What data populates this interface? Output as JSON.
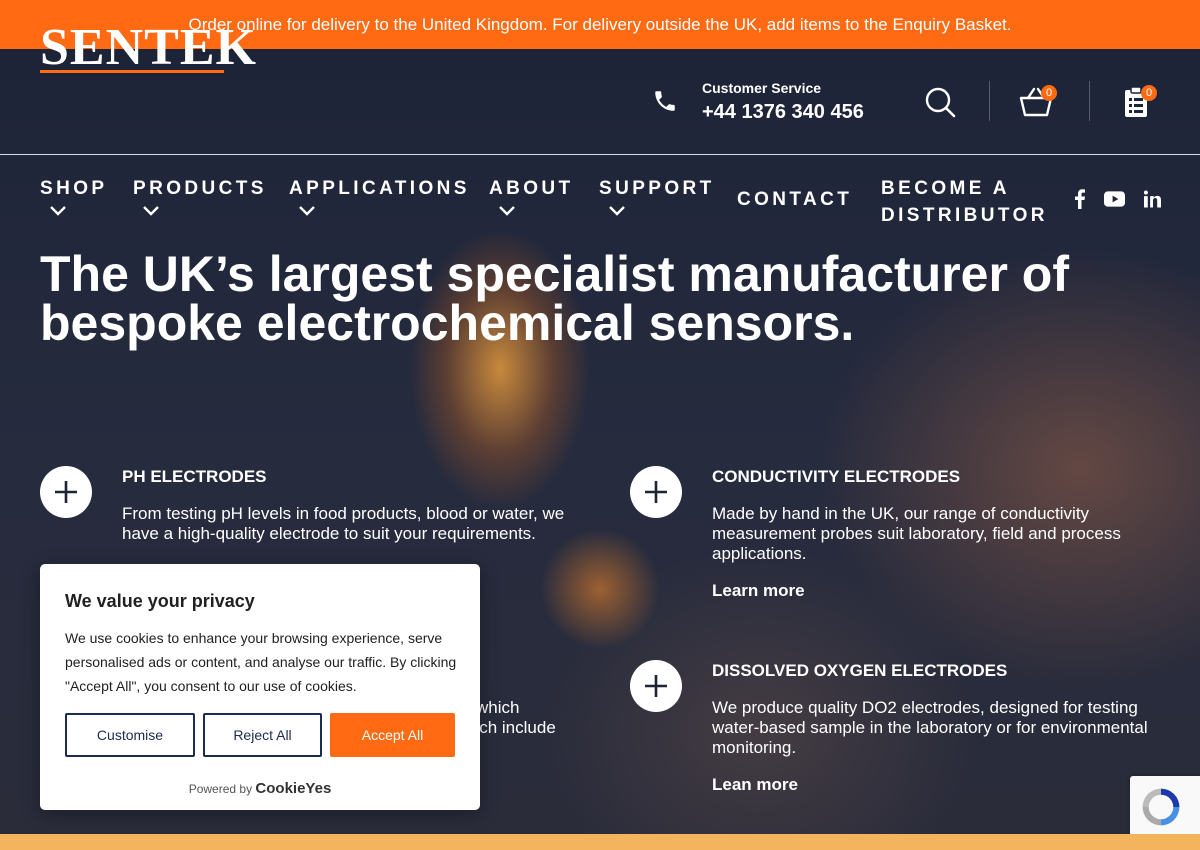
{
  "topbar": {
    "message": "Order online for delivery to the United Kingdom. For delivery outside the UK, add items to the Enquiry Basket."
  },
  "header": {
    "logo": "SENTEK",
    "customer_service_label": "Customer Service",
    "phone": "+44 1376 340 456",
    "cart_count": "0",
    "enquiry_count": "0"
  },
  "nav": {
    "items": [
      {
        "label": "SHOP",
        "dropdown": true
      },
      {
        "label": "PRODUCTS",
        "dropdown": true
      },
      {
        "label": "APPLICATIONS",
        "dropdown": true
      },
      {
        "label": "ABOUT",
        "dropdown": true
      },
      {
        "label": "SUPPORT",
        "dropdown": true
      },
      {
        "label": "CONTACT",
        "dropdown": false
      },
      {
        "label": "BECOME A DISTRIBUTOR",
        "dropdown": false
      }
    ],
    "social": [
      "facebook-icon",
      "youtube-icon",
      "linkedin-icon"
    ]
  },
  "hero": {
    "headline": "The UK’s largest specialist manufacturer of bespoke electrochemical sensors."
  },
  "features": [
    {
      "title": "PH ELECTRODES",
      "description": "From testing pH levels in food products, blood or water, we have a high-quality electrode to suit your requirements.",
      "link": ""
    },
    {
      "title": "CONDUCTIVITY ELECTRODES",
      "description": "Made by hand in the UK, our range of conductivity measurement probes suit laboratory, field and process applications.",
      "link": "Learn more"
    },
    {
      "title": "DISSOLVED OXYGEN ELECTRODES",
      "description": "We produce quality DO2 electrodes, designed for testing water-based sample in the laboratory or for environmental monitoring.",
      "link": "Lean more"
    }
  ],
  "partial_text": {
    "line1": "which",
    "line2": "hich include"
  },
  "cookie": {
    "title": "We value your privacy",
    "body": "We use cookies to enhance your browsing experience, serve personalised ads or content, and analyse our traffic. By clicking \"Accept All\", you consent to our use of cookies.",
    "customise": "Customise",
    "reject": "Reject All",
    "accept": "Accept All",
    "powered_by": "Powered by",
    "brand": "CookieYes"
  },
  "colors": {
    "accent": "#ff6a13",
    "button_border": "#1c2b52",
    "bottom_strip": "#f4b45e"
  }
}
